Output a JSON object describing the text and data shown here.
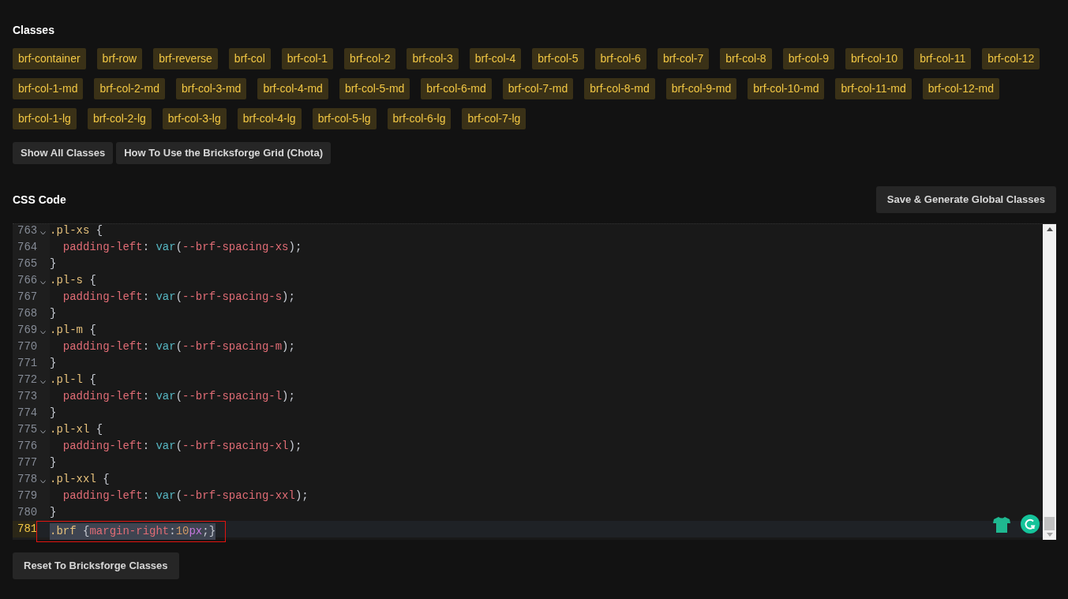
{
  "classes": {
    "title": "Classes",
    "tags": [
      {
        "label": "brf-container"
      },
      {
        "label": "brf-row"
      },
      {
        "label": "brf-reverse"
      },
      {
        "label": "brf-col"
      },
      {
        "label": "brf-col-1"
      },
      {
        "label": "brf-col-2"
      },
      {
        "label": "brf-col-3"
      },
      {
        "label": "brf-col-4"
      },
      {
        "label": "brf-col-5"
      },
      {
        "label": "brf-col-6"
      },
      {
        "label": "brf-col-7"
      },
      {
        "label": "brf-col-8"
      },
      {
        "label": "brf-col-9"
      },
      {
        "label": "brf-col-10"
      },
      {
        "label": "brf-col-11"
      },
      {
        "label": "brf-col-12"
      },
      {
        "label": "brf-col-1-md"
      },
      {
        "label": "brf-col-2-md"
      },
      {
        "label": "brf-col-3-md"
      },
      {
        "label": "brf-col-4-md"
      },
      {
        "label": "brf-col-5-md"
      },
      {
        "label": "brf-col-6-md"
      },
      {
        "label": "brf-col-7-md"
      },
      {
        "label": "brf-col-8-md"
      },
      {
        "label": "brf-col-9-md"
      },
      {
        "label": "brf-col-10-md"
      },
      {
        "label": "brf-col-11-md"
      },
      {
        "label": "brf-col-12-md"
      },
      {
        "label": "brf-col-1-lg"
      },
      {
        "label": "brf-col-2-lg"
      },
      {
        "label": "brf-col-3-lg"
      },
      {
        "label": "brf-col-4-lg"
      },
      {
        "label": "brf-col-5-lg"
      },
      {
        "label": "brf-col-6-lg"
      },
      {
        "label": "brf-col-7-lg"
      }
    ],
    "buttons": [
      "Show All Classes",
      "How To Use the Bricksforge Grid (Chota)"
    ]
  },
  "css_code": {
    "title": "CSS Code",
    "save_button": "Save & Generate Global Classes",
    "lines": [
      {
        "number": "763",
        "foldable": true,
        "active": false,
        "tokens": [
          {
            "kind": "selector",
            "text": ".pl-xs"
          },
          {
            "kind": "punct",
            "text": " {"
          }
        ]
      },
      {
        "number": "764",
        "foldable": false,
        "active": false,
        "tokens": [
          {
            "kind": "prop",
            "text": "  padding-left"
          },
          {
            "kind": "punct",
            "text": ": "
          },
          {
            "kind": "func",
            "text": "var"
          },
          {
            "kind": "punct",
            "text": "("
          },
          {
            "kind": "var",
            "text": "--brf-spacing-xs"
          },
          {
            "kind": "punct",
            "text": ");"
          }
        ]
      },
      {
        "number": "765",
        "foldable": false,
        "active": false,
        "tokens": [
          {
            "kind": "punct",
            "text": "}"
          }
        ]
      },
      {
        "number": "766",
        "foldable": true,
        "active": false,
        "tokens": [
          {
            "kind": "selector",
            "text": ".pl-s"
          },
          {
            "kind": "punct",
            "text": " {"
          }
        ]
      },
      {
        "number": "767",
        "foldable": false,
        "active": false,
        "tokens": [
          {
            "kind": "prop",
            "text": "  padding-left"
          },
          {
            "kind": "punct",
            "text": ": "
          },
          {
            "kind": "func",
            "text": "var"
          },
          {
            "kind": "punct",
            "text": "("
          },
          {
            "kind": "var",
            "text": "--brf-spacing-s"
          },
          {
            "kind": "punct",
            "text": ");"
          }
        ]
      },
      {
        "number": "768",
        "foldable": false,
        "active": false,
        "tokens": [
          {
            "kind": "punct",
            "text": "}"
          }
        ]
      },
      {
        "number": "769",
        "foldable": true,
        "active": false,
        "tokens": [
          {
            "kind": "selector",
            "text": ".pl-m"
          },
          {
            "kind": "punct",
            "text": " {"
          }
        ]
      },
      {
        "number": "770",
        "foldable": false,
        "active": false,
        "tokens": [
          {
            "kind": "prop",
            "text": "  padding-left"
          },
          {
            "kind": "punct",
            "text": ": "
          },
          {
            "kind": "func",
            "text": "var"
          },
          {
            "kind": "punct",
            "text": "("
          },
          {
            "kind": "var",
            "text": "--brf-spacing-m"
          },
          {
            "kind": "punct",
            "text": ");"
          }
        ]
      },
      {
        "number": "771",
        "foldable": false,
        "active": false,
        "tokens": [
          {
            "kind": "punct",
            "text": "}"
          }
        ]
      },
      {
        "number": "772",
        "foldable": true,
        "active": false,
        "tokens": [
          {
            "kind": "selector",
            "text": ".pl-l"
          },
          {
            "kind": "punct",
            "text": " {"
          }
        ]
      },
      {
        "number": "773",
        "foldable": false,
        "active": false,
        "tokens": [
          {
            "kind": "prop",
            "text": "  padding-left"
          },
          {
            "kind": "punct",
            "text": ": "
          },
          {
            "kind": "func",
            "text": "var"
          },
          {
            "kind": "punct",
            "text": "("
          },
          {
            "kind": "var",
            "text": "--brf-spacing-l"
          },
          {
            "kind": "punct",
            "text": ");"
          }
        ]
      },
      {
        "number": "774",
        "foldable": false,
        "active": false,
        "tokens": [
          {
            "kind": "punct",
            "text": "}"
          }
        ]
      },
      {
        "number": "775",
        "foldable": true,
        "active": false,
        "tokens": [
          {
            "kind": "selector",
            "text": ".pl-xl"
          },
          {
            "kind": "punct",
            "text": " {"
          }
        ]
      },
      {
        "number": "776",
        "foldable": false,
        "active": false,
        "tokens": [
          {
            "kind": "prop",
            "text": "  padding-left"
          },
          {
            "kind": "punct",
            "text": ": "
          },
          {
            "kind": "func",
            "text": "var"
          },
          {
            "kind": "punct",
            "text": "("
          },
          {
            "kind": "var",
            "text": "--brf-spacing-xl"
          },
          {
            "kind": "punct",
            "text": ");"
          }
        ]
      },
      {
        "number": "777",
        "foldable": false,
        "active": false,
        "tokens": [
          {
            "kind": "punct",
            "text": "}"
          }
        ]
      },
      {
        "number": "778",
        "foldable": true,
        "active": false,
        "tokens": [
          {
            "kind": "selector",
            "text": ".pl-xxl"
          },
          {
            "kind": "punct",
            "text": " {"
          }
        ]
      },
      {
        "number": "779",
        "foldable": false,
        "active": false,
        "tokens": [
          {
            "kind": "prop",
            "text": "  padding-left"
          },
          {
            "kind": "punct",
            "text": ": "
          },
          {
            "kind": "func",
            "text": "var"
          },
          {
            "kind": "punct",
            "text": "("
          },
          {
            "kind": "var",
            "text": "--brf-spacing-xxl"
          },
          {
            "kind": "punct",
            "text": ");"
          }
        ]
      },
      {
        "number": "780",
        "foldable": false,
        "active": false,
        "tokens": [
          {
            "kind": "punct",
            "text": "}"
          }
        ]
      },
      {
        "number": "781",
        "foldable": false,
        "active": true,
        "selected": true,
        "tokens": [
          {
            "kind": "selector",
            "text": ".brf"
          },
          {
            "kind": "punct",
            "text": " {"
          },
          {
            "kind": "prop",
            "text": "margin-right"
          },
          {
            "kind": "punct",
            "text": ":"
          },
          {
            "kind": "num",
            "text": "10"
          },
          {
            "kind": "unit",
            "text": "px"
          },
          {
            "kind": "punct",
            "text": ";}"
          }
        ]
      }
    ],
    "reset_button": "Reset To Bricksforge Classes"
  }
}
